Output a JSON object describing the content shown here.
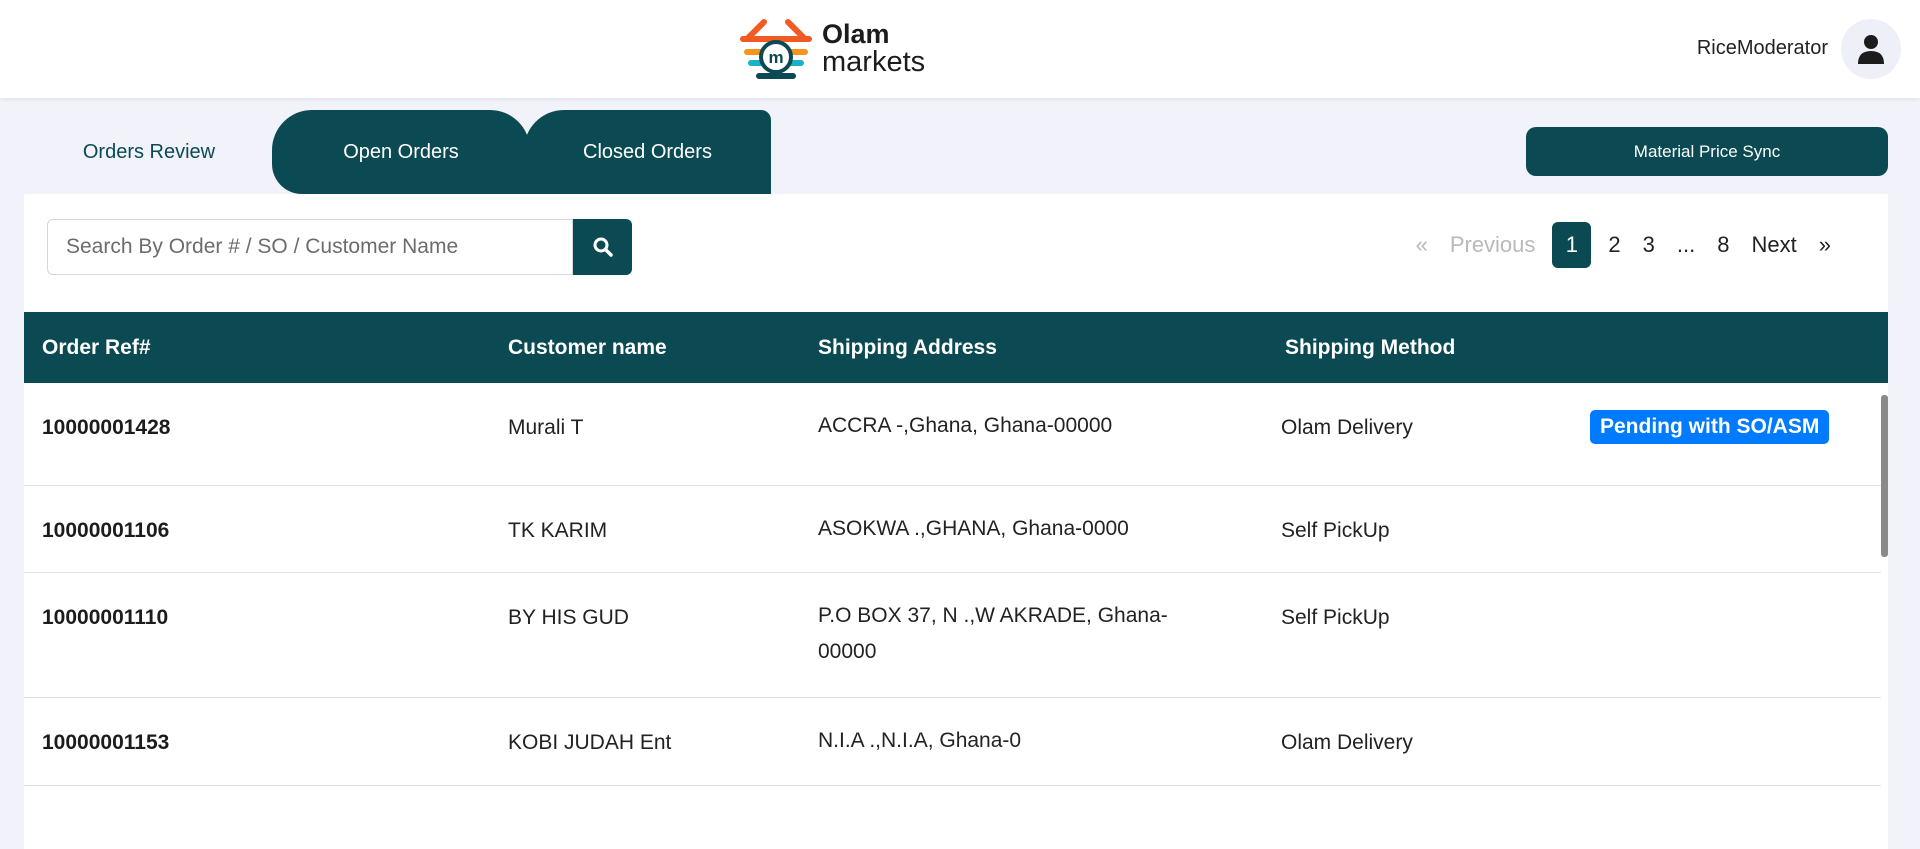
{
  "header": {
    "logo_line1": "Olam",
    "logo_line2": "markets",
    "username": "RiceModerator"
  },
  "tabs": [
    {
      "label": "Orders Review",
      "active": true
    },
    {
      "label": "Open Orders"
    },
    {
      "label": "Closed Orders"
    }
  ],
  "material_price_sync_label": "Material Price Sync",
  "search": {
    "placeholder": "Search By Order # / SO / Customer Name",
    "value": ""
  },
  "pagination": {
    "previous": "Previous",
    "prev_icon": "«",
    "next": "Next",
    "next_icon": "»",
    "pages": [
      "1",
      "2",
      "3",
      "...",
      "8"
    ],
    "current": "1"
  },
  "table": {
    "columns": [
      "Order Ref#",
      "Customer name",
      "Shipping Address",
      "Shipping Method"
    ],
    "rows": [
      {
        "order": "10000001428",
        "customer": "Murali T",
        "address": "ACCRA -,Ghana, Ghana-00000",
        "method": "Olam Delivery",
        "status": "Pending with SO/ASM"
      },
      {
        "order": "10000001106",
        "customer": "TK KARIM",
        "address": "ASOKWA .,GHANA, Ghana-0000",
        "method": "Self PickUp"
      },
      {
        "order": "10000001110",
        "customer": "BY HIS GUD",
        "address": "P.O BOX 37, N .,W AKRADE, Ghana-00000",
        "method": "Self PickUp"
      },
      {
        "order": "10000001153",
        "customer": "KOBI JUDAH Ent",
        "address": "N.I.A .,N.I.A, Ghana-0",
        "method": "Olam Delivery"
      }
    ]
  },
  "colors": {
    "primary": "#0b4a52",
    "badge": "#007bff",
    "background": "#f1f2fa"
  }
}
